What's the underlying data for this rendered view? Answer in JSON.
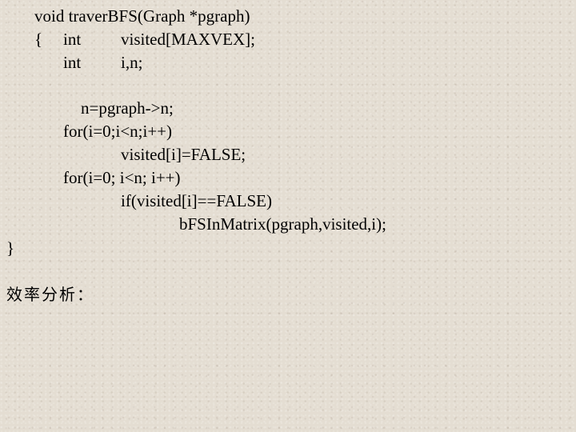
{
  "code": {
    "signature": "void traverBFS(Graph *pgraph)",
    "open_brace": "{",
    "decl1_type": "int",
    "decl1_name": "visited[MAXVEX];",
    "decl2_type": "int",
    "decl2_name": "i,n;",
    "assign_n": "n=pgraph->n;",
    "for1": "for(i=0;i<n;i++)",
    "for1_body": "visited[i]=FALSE;",
    "for2": "for(i=0; i<n; i++)",
    "if_stmt": "if(visited[i]==FALSE)",
    "call_stmt": "bFSInMatrix(pgraph,visited,i);",
    "close_brace": "}"
  },
  "analysis_heading": "效率分析："
}
